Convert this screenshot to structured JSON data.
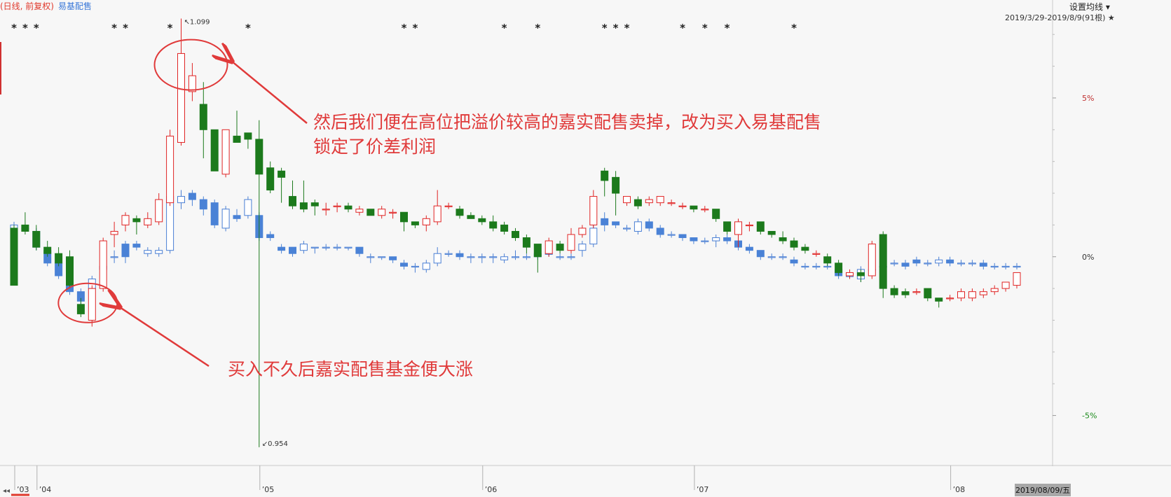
{
  "chart_data": {
    "type": "candlestick",
    "legend_main": "(日线, 前复权)",
    "legend_compare": "易基配售",
    "settings_label": "设置均线",
    "date_range": "2019/3/29-2019/8/9(91根)",
    "y_ticks": [
      {
        "value": 5,
        "label": "5%"
      },
      {
        "value": 0,
        "label": "0%"
      },
      {
        "value": -5,
        "label": "-5%"
      }
    ],
    "ylim": [
      -6.2,
      7.6
    ],
    "x_labels": [
      {
        "index": 0,
        "label": "03"
      },
      {
        "index": 2,
        "label": "04"
      },
      {
        "index": 22,
        "label": "05"
      },
      {
        "index": 42,
        "label": "06"
      },
      {
        "index": 61,
        "label": "07"
      },
      {
        "index": 84,
        "label": "08"
      }
    ],
    "current_date_label": "2019/08/09/五",
    "max_label": "1.099",
    "min_label": "0.954",
    "series": [
      {
        "name": "嘉实配售",
        "candles": [
          [
            0.9,
            -0.9,
            1.0,
            -0.9
          ],
          [
            1.0,
            0.8,
            1.4,
            0.7
          ],
          [
            0.8,
            0.3,
            1.0,
            0.2
          ],
          [
            0.3,
            0.1,
            0.5,
            0.0
          ],
          [
            0.1,
            -0.2,
            0.3,
            -0.3
          ],
          [
            0.0,
            -0.9,
            0.2,
            -1.0
          ],
          [
            -1.5,
            -1.8,
            -1.3,
            -1.9
          ],
          [
            -2.0,
            -1.0,
            -0.9,
            -2.2
          ],
          [
            -1.0,
            0.5,
            0.6,
            -1.1
          ],
          [
            0.7,
            0.8,
            1.1,
            0.3
          ],
          [
            1.0,
            1.3,
            1.4,
            0.8
          ],
          [
            1.2,
            1.1,
            1.3,
            0.7
          ],
          [
            1.0,
            1.2,
            1.4,
            0.9
          ],
          [
            1.1,
            1.8,
            2.0,
            1.0
          ],
          [
            1.7,
            3.8,
            4.0,
            1.6
          ],
          [
            3.6,
            6.4,
            7.5,
            3.5
          ],
          [
            5.2,
            5.7,
            6.1,
            4.9
          ],
          [
            4.8,
            4.0,
            5.5,
            3.1
          ],
          [
            4.0,
            2.7,
            3.8,
            2.8
          ],
          [
            2.6,
            4.0,
            4.0,
            2.5
          ],
          [
            3.8,
            3.6,
            4.6,
            3.6
          ],
          [
            3.9,
            3.7,
            3.9,
            3.4
          ],
          [
            3.7,
            2.6,
            4.3,
            -6.0
          ],
          [
            2.8,
            2.1,
            3.0,
            2.0
          ],
          [
            2.7,
            2.5,
            2.8,
            1.7
          ],
          [
            1.9,
            1.6,
            2.4,
            1.5
          ],
          [
            1.7,
            1.5,
            2.4,
            1.4
          ],
          [
            1.7,
            1.6,
            1.8,
            1.3
          ],
          [
            1.5,
            1.5,
            1.7,
            1.3
          ],
          [
            1.6,
            1.6,
            1.7,
            1.4
          ],
          [
            1.6,
            1.5,
            1.7,
            1.4
          ],
          [
            1.4,
            1.5,
            1.6,
            1.3
          ],
          [
            1.5,
            1.3,
            1.5,
            1.3
          ],
          [
            1.3,
            1.5,
            1.6,
            1.2
          ],
          [
            1.4,
            1.4,
            1.5,
            1.2
          ],
          [
            1.4,
            1.1,
            1.4,
            0.8
          ],
          [
            1.1,
            1.0,
            1.1,
            0.9
          ],
          [
            1.0,
            1.2,
            1.3,
            0.8
          ],
          [
            1.1,
            1.6,
            2.1,
            1.0
          ],
          [
            1.6,
            1.6,
            1.7,
            1.5
          ],
          [
            1.5,
            1.3,
            1.6,
            1.2
          ],
          [
            1.3,
            1.2,
            1.4,
            1.2
          ],
          [
            1.2,
            1.1,
            1.3,
            1.0
          ],
          [
            1.1,
            0.9,
            1.3,
            0.8
          ],
          [
            1.0,
            0.8,
            1.1,
            0.7
          ],
          [
            0.8,
            0.6,
            0.9,
            0.5
          ],
          [
            0.6,
            0.3,
            0.7,
            0.1
          ],
          [
            0.4,
            0.0,
            0.4,
            -0.5
          ],
          [
            0.1,
            0.5,
            0.6,
            0.0
          ],
          [
            0.4,
            0.2,
            0.5,
            0.1
          ],
          [
            0.2,
            0.7,
            0.9,
            0.1
          ],
          [
            0.7,
            0.9,
            1.0,
            0.6
          ],
          [
            1.0,
            1.9,
            2.1,
            0.9
          ],
          [
            2.7,
            2.4,
            2.8,
            1.9
          ],
          [
            2.5,
            2.0,
            2.7,
            1.3
          ],
          [
            1.7,
            1.9,
            1.9,
            1.6
          ],
          [
            1.8,
            1.6,
            1.9,
            1.5
          ],
          [
            1.7,
            1.8,
            1.9,
            1.6
          ],
          [
            1.7,
            1.9,
            1.9,
            1.6
          ],
          [
            1.7,
            1.7,
            1.8,
            1.6
          ],
          [
            1.6,
            1.6,
            1.7,
            1.5
          ],
          [
            1.6,
            1.5,
            1.6,
            1.4
          ],
          [
            1.5,
            1.5,
            1.6,
            1.4
          ],
          [
            1.5,
            1.2,
            1.5,
            1.1
          ],
          [
            1.1,
            0.8,
            1.1,
            0.7
          ],
          [
            0.7,
            1.1,
            1.2,
            0.3
          ],
          [
            1.0,
            1.0,
            1.1,
            0.8
          ],
          [
            1.1,
            0.8,
            1.1,
            0.7
          ],
          [
            0.8,
            0.7,
            0.8,
            0.6
          ],
          [
            0.6,
            0.5,
            0.8,
            0.4
          ],
          [
            0.5,
            0.3,
            0.6,
            0.2
          ],
          [
            0.3,
            0.2,
            0.4,
            0.1
          ],
          [
            0.1,
            0.1,
            0.2,
            0.0
          ],
          [
            0.0,
            -0.2,
            0.1,
            -0.3
          ],
          [
            -0.2,
            -0.5,
            -0.1,
            -0.6
          ],
          [
            -0.6,
            -0.5,
            -0.4,
            -0.7
          ],
          [
            -0.5,
            -0.6,
            -0.4,
            -0.8
          ],
          [
            -0.6,
            0.4,
            0.5,
            -0.7
          ],
          [
            0.7,
            -1.0,
            0.8,
            -1.3
          ],
          [
            -1.0,
            -1.2,
            -0.9,
            -1.3
          ],
          [
            -1.1,
            -1.2,
            -1.0,
            -1.3
          ],
          [
            -1.1,
            -1.1,
            -1.0,
            -1.2
          ],
          [
            -1.0,
            -1.3,
            -1.0,
            -1.4
          ],
          [
            -1.3,
            -1.4,
            -1.3,
            -1.6
          ],
          [
            -1.3,
            -1.3,
            -1.2,
            -1.4
          ],
          [
            -1.3,
            -1.1,
            -1.0,
            -1.4
          ],
          [
            -1.3,
            -1.1,
            -1.0,
            -1.4
          ],
          [
            -1.2,
            -1.1,
            -1.0,
            -1.3
          ],
          [
            -1.1,
            -1.0,
            -0.9,
            -1.2
          ],
          [
            -1.0,
            -0.8,
            -0.8,
            -1.1
          ],
          [
            -0.9,
            -0.5,
            -0.5,
            -1.0
          ]
        ]
      },
      {
        "name": "易基配售",
        "candles": [
          [
            0.9,
            1.0,
            1.1,
            0.8
          ],
          [
            0.9,
            0.9,
            1.0,
            0.8
          ],
          [
            0.8,
            0.3,
            0.9,
            0.2
          ],
          [
            0.2,
            -0.2,
            0.3,
            -0.3
          ],
          [
            -0.2,
            -0.6,
            -0.1,
            -0.7
          ],
          [
            -0.6,
            -1.1,
            -0.5,
            -1.2
          ],
          [
            -1.1,
            -1.4,
            -1.0,
            -1.5
          ],
          [
            -1.0,
            -0.7,
            -0.6,
            -1.1
          ],
          [
            -0.4,
            -0.3,
            -0.2,
            -0.4
          ],
          [
            0.0,
            0.0,
            0.2,
            -0.2
          ],
          [
            0.4,
            0.0,
            0.5,
            -0.2
          ],
          [
            0.4,
            0.3,
            0.5,
            0.2
          ],
          [
            0.1,
            0.2,
            0.3,
            0.0
          ],
          [
            0.1,
            0.2,
            0.3,
            0.0
          ],
          [
            0.2,
            1.9,
            2.6,
            0.1
          ],
          [
            1.7,
            1.9,
            2.1,
            1.5
          ],
          [
            2.0,
            1.8,
            2.1,
            1.6
          ],
          [
            1.8,
            1.5,
            1.9,
            1.3
          ],
          [
            1.7,
            1.0,
            1.8,
            0.9
          ],
          [
            0.9,
            1.5,
            1.6,
            0.8
          ],
          [
            1.3,
            1.2,
            1.5,
            1.1
          ],
          [
            1.3,
            1.8,
            1.9,
            1.2
          ],
          [
            1.3,
            0.6,
            1.4,
            0.5
          ],
          [
            0.7,
            0.6,
            0.8,
            0.5
          ],
          [
            0.3,
            0.2,
            0.4,
            0.1
          ],
          [
            0.3,
            0.1,
            0.3,
            0.0
          ],
          [
            0.2,
            0.4,
            0.5,
            0.1
          ],
          [
            0.3,
            0.3,
            0.3,
            0.1
          ],
          [
            0.3,
            0.3,
            0.4,
            0.2
          ],
          [
            0.3,
            0.3,
            0.4,
            0.2
          ],
          [
            0.3,
            0.3,
            0.3,
            0.2
          ],
          [
            0.3,
            0.1,
            0.3,
            0.0
          ],
          [
            0.0,
            0.0,
            0.1,
            -0.2
          ],
          [
            0.0,
            0.0,
            0.0,
            -0.1
          ],
          [
            0.0,
            -0.1,
            0.0,
            -0.2
          ],
          [
            -0.2,
            -0.3,
            -0.1,
            -0.4
          ],
          [
            -0.3,
            -0.3,
            -0.2,
            -0.5
          ],
          [
            -0.4,
            -0.2,
            -0.1,
            -0.5
          ],
          [
            -0.2,
            0.1,
            0.3,
            -0.3
          ],
          [
            0.1,
            0.1,
            0.2,
            0.0
          ],
          [
            0.1,
            0.0,
            0.2,
            -0.1
          ],
          [
            0.0,
            0.0,
            0.1,
            -0.2
          ],
          [
            0.0,
            0.0,
            0.1,
            -0.2
          ],
          [
            0.0,
            0.0,
            0.1,
            -0.2
          ],
          [
            -0.1,
            0.0,
            0.1,
            -0.2
          ],
          [
            0.0,
            0.0,
            0.2,
            -0.1
          ],
          [
            0.0,
            0.0,
            0.1,
            -0.1
          ],
          [
            0.0,
            0.1,
            0.2,
            -0.1
          ],
          [
            0.1,
            0.1,
            0.2,
            0.0
          ],
          [
            0.0,
            0.0,
            0.1,
            -0.1
          ],
          [
            0.0,
            0.0,
            0.1,
            -0.1
          ],
          [
            0.2,
            0.4,
            0.5,
            0.0
          ],
          [
            0.4,
            0.9,
            1.1,
            0.3
          ],
          [
            1.2,
            1.0,
            1.4,
            0.8
          ],
          [
            1.1,
            1.0,
            1.1,
            0.9
          ],
          [
            0.9,
            0.9,
            1.0,
            0.8
          ],
          [
            0.8,
            1.1,
            1.2,
            0.7
          ],
          [
            1.1,
            0.9,
            1.2,
            0.8
          ],
          [
            0.9,
            0.7,
            1.0,
            0.6
          ],
          [
            0.7,
            0.7,
            0.8,
            0.6
          ],
          [
            0.7,
            0.6,
            0.7,
            0.5
          ],
          [
            0.6,
            0.5,
            0.6,
            0.4
          ],
          [
            0.5,
            0.5,
            0.6,
            0.4
          ],
          [
            0.5,
            0.6,
            0.7,
            0.3
          ],
          [
            0.6,
            0.5,
            0.7,
            0.4
          ],
          [
            0.5,
            0.3,
            0.6,
            0.2
          ],
          [
            0.3,
            0.2,
            0.4,
            0.1
          ],
          [
            0.2,
            0.0,
            0.2,
            -0.1
          ],
          [
            0.0,
            0.0,
            0.1,
            -0.1
          ],
          [
            0.0,
            0.0,
            0.1,
            -0.1
          ],
          [
            -0.1,
            -0.2,
            0.0,
            -0.3
          ],
          [
            -0.3,
            -0.3,
            -0.2,
            -0.4
          ],
          [
            -0.3,
            -0.3,
            -0.2,
            -0.4
          ],
          [
            -0.3,
            -0.3,
            -0.2,
            -0.4
          ],
          [
            -0.4,
            -0.6,
            -0.3,
            -0.7
          ],
          [
            -0.6,
            -0.6,
            -0.5,
            -0.7
          ],
          [
            -0.7,
            -0.4,
            -0.3,
            -0.8
          ],
          [
            -0.4,
            -0.4,
            -0.3,
            -0.5
          ],
          [
            -0.3,
            -0.3,
            -0.2,
            -0.4
          ],
          [
            -0.2,
            -0.2,
            -0.1,
            -0.3
          ],
          [
            -0.2,
            -0.3,
            -0.1,
            -0.4
          ],
          [
            -0.1,
            -0.2,
            0.0,
            -0.3
          ],
          [
            -0.2,
            -0.2,
            -0.1,
            -0.3
          ],
          [
            -0.2,
            -0.1,
            0.0,
            -0.3
          ],
          [
            -0.1,
            -0.2,
            0.0,
            -0.3
          ],
          [
            -0.2,
            -0.2,
            -0.1,
            -0.3
          ],
          [
            -0.2,
            -0.2,
            -0.1,
            -0.3
          ],
          [
            -0.2,
            -0.3,
            -0.1,
            -0.4
          ],
          [
            -0.3,
            -0.3,
            -0.2,
            -0.4
          ],
          [
            -0.3,
            -0.3,
            -0.2,
            -0.4
          ],
          [
            -0.3,
            -0.3,
            -0.2,
            -0.4
          ]
        ]
      }
    ],
    "event_markers": [
      0,
      1,
      2,
      9,
      10,
      14,
      21,
      35,
      36,
      44,
      47,
      53,
      54,
      55,
      60,
      62,
      64,
      70
    ],
    "annotations": [
      {
        "id": "sell-note",
        "text": [
          "然后我们便在高位把溢价较高的嘉实配售卖掉，改为买入易基配售",
          "锁定了价差利润"
        ],
        "target_index": 15,
        "target_value": 6.0
      },
      {
        "id": "buy-note",
        "text": [
          "买入不久后嘉实配售基金便大涨"
        ],
        "target_index": 7,
        "target_value": -1.5
      }
    ]
  }
}
